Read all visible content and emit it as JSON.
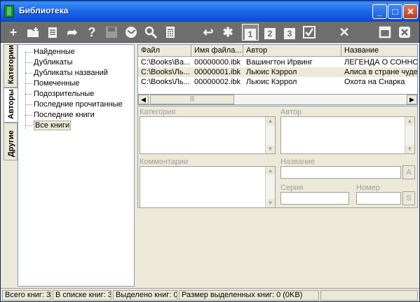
{
  "window": {
    "title": "Библиотека"
  },
  "titlebar_buttons": [
    "_",
    "□",
    "✕"
  ],
  "toolbar": {
    "tab_numbers": [
      "1",
      "2",
      "3"
    ]
  },
  "side_tabs": [
    "Категории",
    "Авторы",
    "Другие"
  ],
  "tree": {
    "items": [
      "Найденные",
      "Дубликаты",
      "Дубликаты названий",
      "Помеченные",
      "Подозрительные",
      "Последние прочитанные",
      "Последние книги",
      "Все книги"
    ],
    "selected": "Все книги"
  },
  "grid": {
    "columns": [
      "Файл",
      "Имя файла...",
      "Автор",
      "Название"
    ],
    "rows": [
      [
        "C:\\Books\\Ва...",
        "00000000.ibk",
        "Вашингтон Ирвинг",
        "ЛЕГЕНДА О СОННОЙ"
      ],
      [
        "C:\\Books\\Ль...",
        "00000001.ibk",
        "Льюис Кэррол",
        "Алиса в стране чудес"
      ],
      [
        "C:\\Books\\Ль...",
        "00000002.ibk",
        "Льюис Кэррол",
        "Охота на Снарка"
      ]
    ],
    "selected_row": 1
  },
  "details": {
    "category_label": "Категория",
    "author_label": "Автор",
    "comments_label": "Комментарии",
    "title_label": "Название",
    "series_label": "Серия",
    "number_label": "Номер",
    "title_button": "A",
    "series_button": "S"
  },
  "status_bar": [
    "Всего книг: 3",
    "В списке книг: 3",
    "Выделено книг: 0",
    "Размер выделенных книг: 0  (0KB)"
  ]
}
